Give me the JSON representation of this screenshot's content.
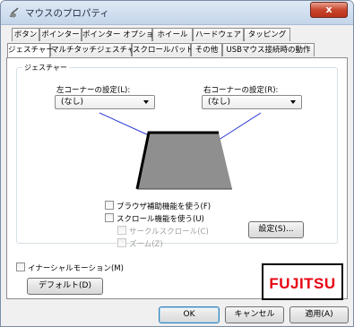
{
  "window": {
    "title": "マウスのプロパティ",
    "close_label": "x"
  },
  "tabs_row1": [
    "ボタン",
    "ポインター",
    "ポインター オプション",
    "ホイール",
    "ハードウェア",
    "タッピング"
  ],
  "tabs_row2": [
    "ジェスチャー",
    "マルチタッチジェスチャー",
    "スクロールパッド",
    "その他",
    "USBマウス接続時の動作"
  ],
  "active_tab": "ジェスチャー",
  "gesture_group": {
    "legend": "ジェスチャー",
    "left_corner_label": "左コーナーの設定(L):",
    "left_corner_value": "(なし)",
    "right_corner_label": "右コーナーの設定(R):",
    "right_corner_value": "(なし)"
  },
  "options": {
    "browser_assist": "ブラウザ補助機能を使う(F)",
    "scroll_function": "スクロール機能を使う(U)",
    "circular_scroll": "サークルスクロール(C)",
    "zoom": "ズーム(Z)",
    "settings_button": "設定(S)..."
  },
  "inertial_motion": "イナーシャルモーション(M)",
  "default_button": "デフォルト(D)",
  "logo_text": "FUJITSU",
  "footer": {
    "ok": "OK",
    "cancel": "キャンセル",
    "apply": "適用(A)"
  },
  "colors": {
    "logo_red": "#e60012",
    "callout_line": "#2b3bd6",
    "pad_fill": "#8f8f8f"
  }
}
